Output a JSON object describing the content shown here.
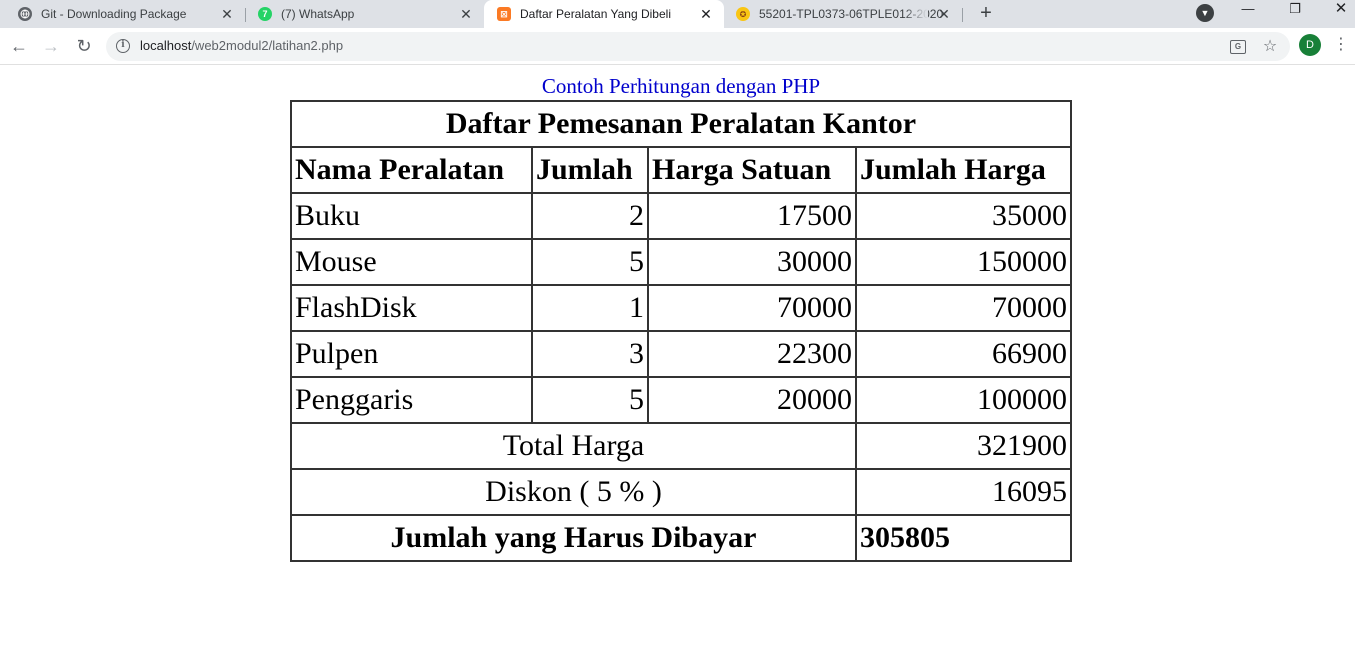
{
  "browser": {
    "tabs": [
      {
        "title": "Git - Downloading Package",
        "icon": "globe-icon",
        "active": false
      },
      {
        "title": "(7) WhatsApp",
        "icon": "whatsapp-icon",
        "active": false
      },
      {
        "title": "Daftar Peralatan Yang Dibeli",
        "icon": "xampp-icon",
        "active": true
      },
      {
        "title": "55201-TPL0373-06TPLE012-2020",
        "icon": "university-icon",
        "active": false
      }
    ],
    "url_host": "localhost",
    "url_path": "/web2modul2/latihan2.php",
    "profile_initial": "D"
  },
  "page": {
    "heading": "Contoh Perhitungan dengan PHP",
    "table_title": "Daftar Pemesanan Peralatan Kantor",
    "columns": [
      "Nama Peralatan",
      "Jumlah",
      "Harga Satuan",
      "Jumlah Harga"
    ],
    "rows": [
      [
        "Buku",
        "2",
        "17500",
        "35000"
      ],
      [
        "Mouse",
        "5",
        "30000",
        "150000"
      ],
      [
        "FlashDisk",
        "1",
        "70000",
        "70000"
      ],
      [
        "Pulpen",
        "3",
        "22300",
        "66900"
      ],
      [
        "Penggaris",
        "5",
        "20000",
        "100000"
      ]
    ],
    "total_label": "Total Harga",
    "total_value": "321900",
    "discount_label": "Diskon ( 5 % )",
    "discount_value": "16095",
    "payable_label": "Jumlah yang Harus Dibayar",
    "payable_value": "305805"
  },
  "colors": {
    "heading": "#0000cc",
    "tabstrip": "#dee1e6",
    "whatsapp": "#25d366",
    "xampp": "#fb7a24",
    "avatar": "#188038"
  }
}
